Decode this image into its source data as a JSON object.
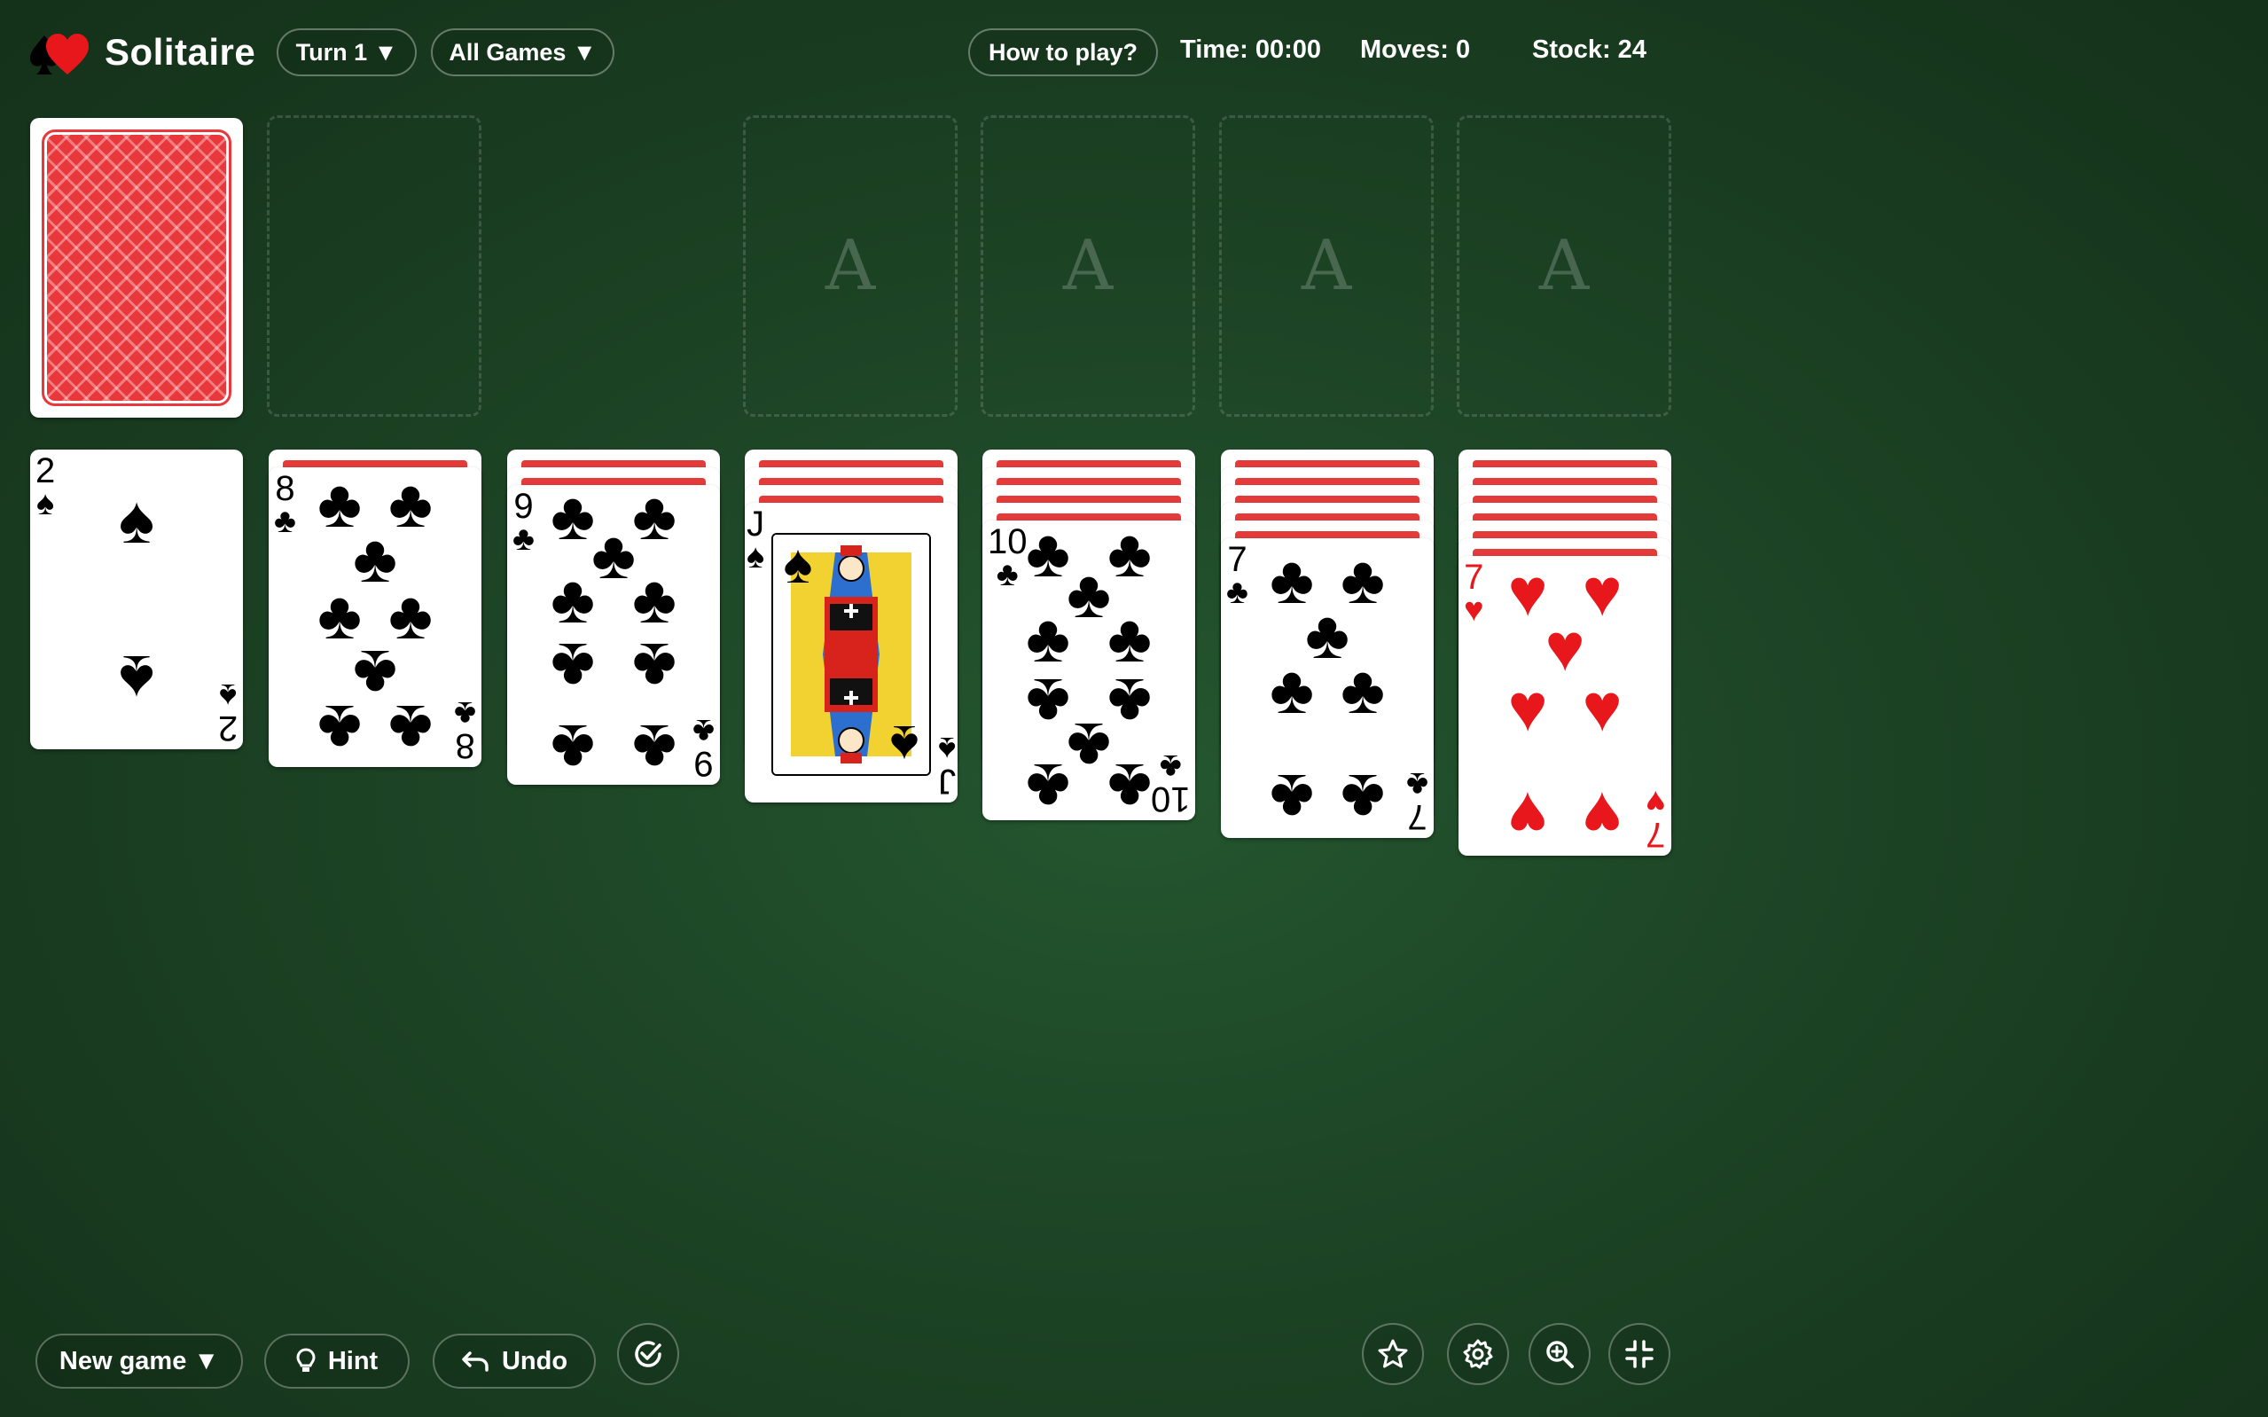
{
  "header": {
    "title": "Solitaire",
    "turn_label": "Turn 1 ▼",
    "games_label": "All Games ▼",
    "help_label": "How to play?",
    "time_text": "Time: 00:00",
    "moves_text": "Moves: 0",
    "stock_text": "Stock: 24"
  },
  "board": {
    "foundation_letter": "A",
    "tableau": [
      {
        "facedown": 0,
        "rank": "2",
        "suit": "♠",
        "color": "black"
      },
      {
        "facedown": 1,
        "rank": "8",
        "suit": "♣",
        "color": "black"
      },
      {
        "facedown": 2,
        "rank": "9",
        "suit": "♣",
        "color": "black"
      },
      {
        "facedown": 3,
        "rank": "J",
        "suit": "♠",
        "color": "black"
      },
      {
        "facedown": 4,
        "rank": "10",
        "suit": "♣",
        "color": "black"
      },
      {
        "facedown": 5,
        "rank": "7",
        "suit": "♣",
        "color": "black"
      },
      {
        "facedown": 6,
        "rank": "7",
        "suit": "♥",
        "color": "red"
      }
    ]
  },
  "footer": {
    "new_game_label": "New game ▼",
    "hint_label": "Hint",
    "undo_label": "Undo"
  },
  "colors": {
    "felt": "#1d4526",
    "card_back": "#e8383c",
    "red_suit": "#e8171c"
  },
  "icons": [
    "spade-logo-icon",
    "heart-logo-icon",
    "lightbulb-icon",
    "undo-icon",
    "check-circle-icon",
    "star-icon",
    "gear-icon",
    "zoom-in-icon",
    "compress-icon"
  ]
}
